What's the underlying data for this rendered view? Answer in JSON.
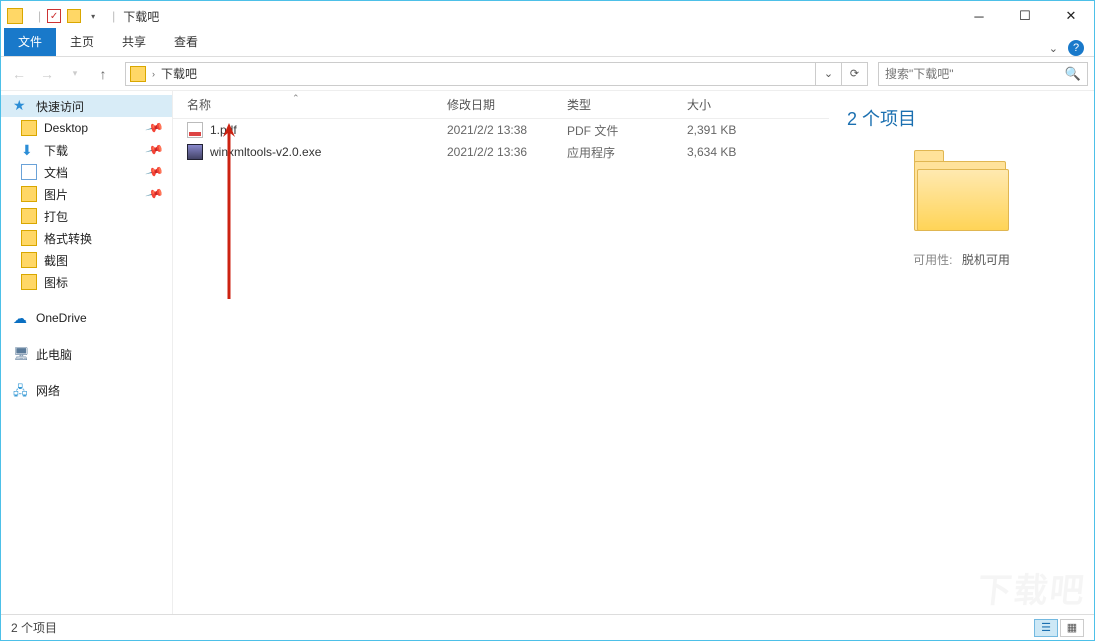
{
  "title": "下载吧",
  "ribbon": {
    "file": "文件",
    "tabs": [
      "主页",
      "共享",
      "查看"
    ]
  },
  "nav": {
    "crumb": "下载吧",
    "search_placeholder": "搜索\"下载吧\""
  },
  "sidebar": {
    "quick": "快速访问",
    "items": [
      {
        "label": "Desktop",
        "icon": "folder",
        "pin": true
      },
      {
        "label": "下载",
        "icon": "dl",
        "pin": true
      },
      {
        "label": "文档",
        "icon": "doc",
        "pin": true
      },
      {
        "label": "图片",
        "icon": "folder",
        "pin": true
      },
      {
        "label": "打包",
        "icon": "folder",
        "pin": false
      },
      {
        "label": "格式转换",
        "icon": "folder",
        "pin": false
      },
      {
        "label": "截图",
        "icon": "folder",
        "pin": false
      },
      {
        "label": "图标",
        "icon": "folder",
        "pin": false
      }
    ],
    "onedrive": "OneDrive",
    "thispc": "此电脑",
    "network": "网络"
  },
  "columns": {
    "name": "名称",
    "date": "修改日期",
    "type": "类型",
    "size": "大小"
  },
  "files": [
    {
      "name": "1.pdf",
      "date": "2021/2/2 13:38",
      "type": "PDF 文件",
      "size": "2,391 KB",
      "icon": "pdf"
    },
    {
      "name": "winxmltools-v2.0.exe",
      "date": "2021/2/2 13:36",
      "type": "应用程序",
      "size": "3,634 KB",
      "icon": "exe"
    }
  ],
  "details": {
    "count": "2 个项目",
    "avail_label": "可用性:",
    "avail_value": "脱机可用"
  },
  "status": {
    "text": "2 个项目"
  }
}
